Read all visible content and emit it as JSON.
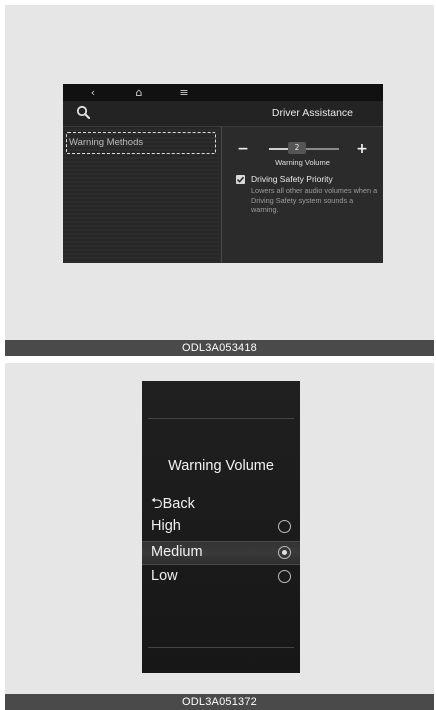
{
  "top_figure": {
    "caption": "ODL3A053418",
    "nav": {
      "back_icon": "‹",
      "home_icon": "⌂",
      "menu_icon": "≡"
    },
    "header": {
      "title": "Driver Assistance"
    },
    "left_list": {
      "items": [
        {
          "label": "Warning Methods"
        }
      ]
    },
    "volume": {
      "minus_label": "−",
      "plus_label": "+",
      "value": "2",
      "level_fraction": 0.4,
      "label": "Warning Volume"
    },
    "driving_safety_priority": {
      "checked": true,
      "title": "Driving Safety Priority",
      "description": "Lowers all other audio volumes when a Driving Safety system sounds a warning."
    }
  },
  "bottom_figure": {
    "caption": "ODL3A051372",
    "title": "Warning Volume",
    "back_label": "⮌Back",
    "options": [
      {
        "label": "High",
        "selected": false
      },
      {
        "label": "Medium",
        "selected": true
      },
      {
        "label": "Low",
        "selected": false
      }
    ]
  },
  "colors": {
    "panel_bg": "#e6e6e6",
    "caption_bar": "#4a4a4a",
    "screen_bg": "#2a2a2a"
  }
}
